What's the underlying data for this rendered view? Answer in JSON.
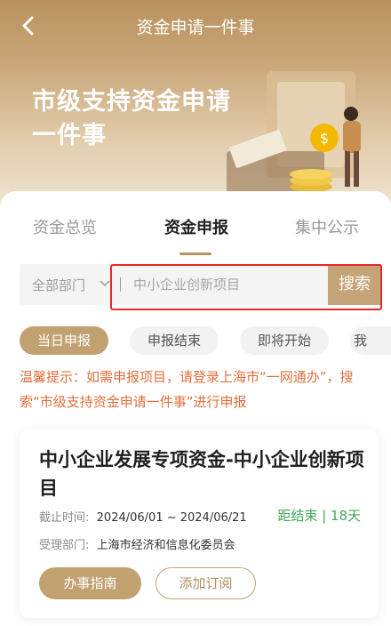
{
  "header": {
    "title": "资金申请一件事",
    "hero_title": "市级支持资金申请一件事"
  },
  "tabs": [
    {
      "label": "资金总览",
      "active": false
    },
    {
      "label": "资金申报",
      "active": true
    },
    {
      "label": "集中公示",
      "active": false
    }
  ],
  "filter": {
    "department": "全部部门",
    "search_placeholder": "中小企业创新项目",
    "search_button": "搜索"
  },
  "status_pills": [
    {
      "label": "当日申报",
      "active": true
    },
    {
      "label": "申报结束",
      "active": false
    },
    {
      "label": "即将开始",
      "active": false
    },
    {
      "label": "我",
      "active": false
    }
  ],
  "tip": "温馨提示：如需申报项目，请登录上海市“一网通办”，搜索“市级支持资金申请一件事”进行申报",
  "project": {
    "title": "中小企业发展专项资金-中小企业创新项目",
    "deadline_label": "截止时间:",
    "deadline_value": "2024/06/01 ~ 2024/06/21",
    "countdown": "距结束 | 18天",
    "dept_label": "受理部门:",
    "dept_value": "上海市经济和信息化委员会",
    "guide_button": "办事指南",
    "subscribe_button": "添加订阅"
  },
  "colors": {
    "brand": "#c2a171",
    "tip": "#e26e3b",
    "countdown": "#3eaa55",
    "highlight_box": "#e8262a"
  }
}
